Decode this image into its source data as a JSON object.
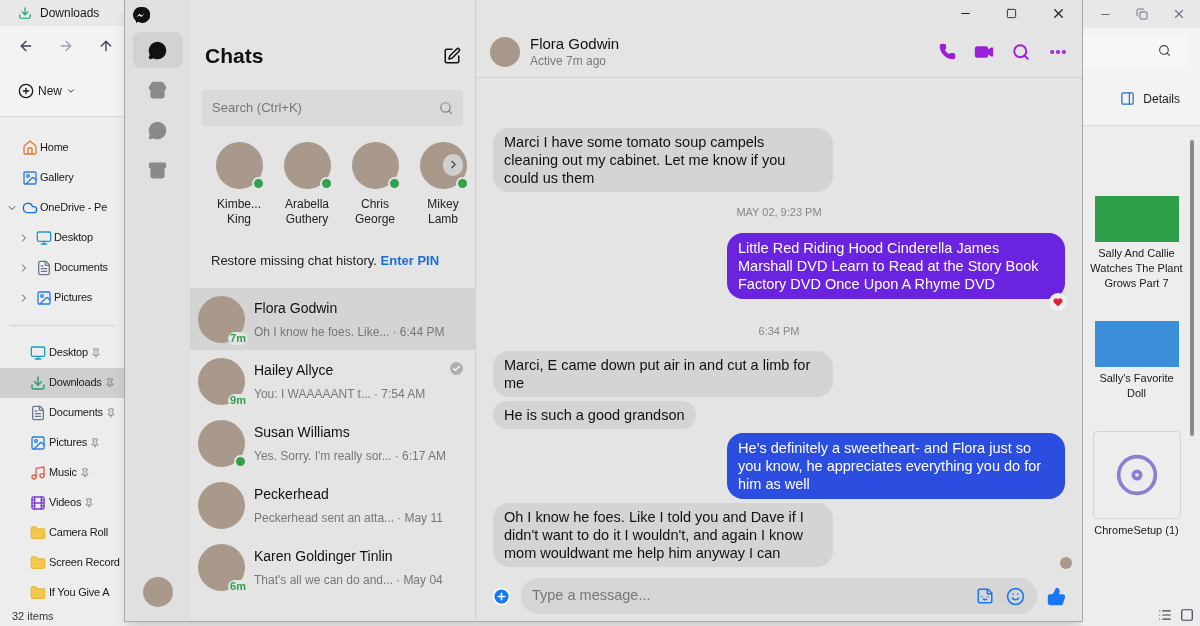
{
  "explorer": {
    "tab_title": "Downloads",
    "new_button": "New",
    "details_button": "Details",
    "status": "32 items",
    "nav_tree": [
      {
        "label": "Home",
        "kind": "home",
        "expanded": false,
        "selected": false
      },
      {
        "label": "Gallery",
        "kind": "gallery",
        "expanded": false,
        "selected": false
      },
      {
        "label": "OneDrive - Pe",
        "kind": "cloud",
        "expanded": true,
        "selected": false,
        "children": [
          {
            "label": "Desktop",
            "kind": "desktop",
            "expanded": false,
            "selected": false
          },
          {
            "label": "Documents",
            "kind": "documents",
            "expanded": false,
            "selected": false
          },
          {
            "label": "Pictures",
            "kind": "pictures",
            "expanded": false,
            "selected": false
          }
        ]
      }
    ],
    "quick_access": [
      {
        "label": "Desktop",
        "kind": "desktop",
        "pinned": true,
        "selected": false
      },
      {
        "label": "Downloads",
        "kind": "downloads",
        "pinned": true,
        "selected": true
      },
      {
        "label": "Documents",
        "kind": "documents",
        "pinned": true,
        "selected": false
      },
      {
        "label": "Pictures",
        "kind": "pictures",
        "pinned": true,
        "selected": false
      },
      {
        "label": "Music",
        "kind": "music",
        "pinned": true,
        "selected": false
      },
      {
        "label": "Videos",
        "kind": "videos",
        "pinned": true,
        "selected": false
      },
      {
        "label": "Camera Roll",
        "kind": "folder",
        "pinned": false,
        "selected": false
      },
      {
        "label": "Screen Record",
        "kind": "folder",
        "pinned": false,
        "selected": false
      },
      {
        "label": "If You Give A",
        "kind": "folder",
        "pinned": false,
        "selected": false
      }
    ],
    "files": [
      {
        "name": "Sally And Callie Watches The Plant Grows Part 7",
        "kind": "video",
        "color": "#2e9e48"
      },
      {
        "name": "Sally's Favorite Doll",
        "kind": "video",
        "color": "#3a8fd8"
      },
      {
        "name": "ChromeSetup (1)",
        "kind": "installer"
      }
    ]
  },
  "messenger": {
    "rail": [
      {
        "kind": "chats",
        "selected": true
      },
      {
        "kind": "marketplace",
        "selected": false
      },
      {
        "kind": "requests",
        "selected": false
      },
      {
        "kind": "archive",
        "selected": false
      }
    ],
    "chats_title": "Chats",
    "search": {
      "placeholder": "Search (Ctrl+K)"
    },
    "stories": [
      {
        "name": "Kimbe... King",
        "online": true
      },
      {
        "name": "Arabella Guthery",
        "online": true
      },
      {
        "name": "Chris George",
        "online": true
      },
      {
        "name": "Mikey Lamb",
        "online": true
      }
    ],
    "restore": {
      "text": "Restore missing chat history.",
      "link": "Enter PIN"
    },
    "chats": [
      {
        "name": "Flora Godwin",
        "preview": "Oh I know he foes. Like...",
        "time": "· 6:44 PM",
        "badge": "7m",
        "online": false,
        "seen": false,
        "selected": true
      },
      {
        "name": "Hailey Allyce",
        "preview": "You: I WAAAAANT t...",
        "time": "· 7:54 AM",
        "badge": "9m",
        "online": false,
        "seen": true,
        "selected": false
      },
      {
        "name": "Susan Williams",
        "preview": "Yes. Sorry. I'm really sor...",
        "time": "· 6:17 AM",
        "online": true,
        "seen": false,
        "selected": false
      },
      {
        "name": "Peckerhead",
        "preview": "Peckerhead sent an atta...",
        "time": "· May 11",
        "online": false,
        "seen": false,
        "selected": false
      },
      {
        "name": "Karen Goldinger Tinlin",
        "preview": "That's all we can do and...",
        "time": "· May 04",
        "badge": "6m",
        "online": false,
        "seen": false,
        "selected": false
      }
    ],
    "conversation": {
      "name": "Flora Godwin",
      "status": "Active 7m ago",
      "seen_avatar": true,
      "messages": [
        {
          "kind": "incoming",
          "text": "Marci I have some tomato soup campels cleaning out my cabinet. Let me know if you could us them"
        },
        {
          "kind": "timestamp",
          "text": "MAY 02, 9:23 PM"
        },
        {
          "kind": "outgoing",
          "text": "Little Red Riding Hood Cinderella James Marshall DVD Learn to Read at the Story Book Factory DVD Once Upon A Rhyme DVD",
          "color": "#6a24e0",
          "reacted": true
        },
        {
          "kind": "timestamp",
          "text": "6:34 PM"
        },
        {
          "kind": "incoming",
          "text": "Marci, E came down put air in and cut a limb for me"
        },
        {
          "kind": "incoming",
          "text": "He is such a good grandson"
        },
        {
          "kind": "outgoing",
          "text": "He’s definitely a sweetheart- and Flora just so you know, he appreciates everything you do for him as well",
          "color": "#2c4ee0",
          "reacted": false
        },
        {
          "kind": "incoming",
          "text": "Oh I know he foes. Like I told you and Dave if I didn't want to do it I wouldn't, and again I know mom wouldwant me help him anyway I can"
        }
      ],
      "composer": {
        "placeholder": "Type a message..."
      }
    }
  }
}
